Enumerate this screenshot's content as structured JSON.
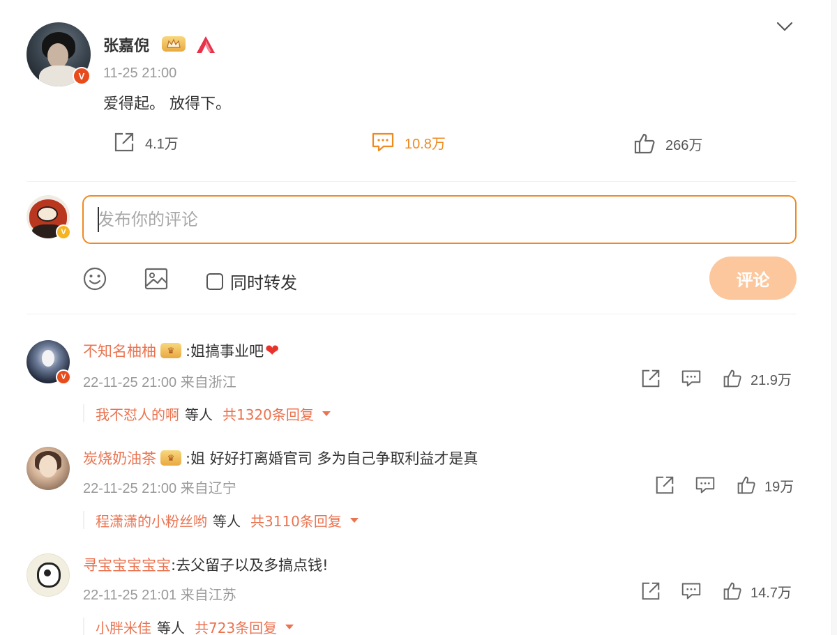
{
  "post": {
    "author": "张嘉倪",
    "time": "11-25 21:00",
    "text": "爱得起。 放得下。",
    "verified_badge": "V",
    "stats": {
      "repost": "4.1万",
      "comment": "10.8万",
      "like": "266万"
    }
  },
  "composer": {
    "placeholder": "发布你的评论",
    "repost_label": "同时转发",
    "submit_label": "评论",
    "verified_badge": "V"
  },
  "comments": [
    {
      "name": "不知名柚柚",
      "text": ":姐搞事业吧",
      "heart": "❤",
      "time": "22-11-25 21:00",
      "location": "来自浙江",
      "likes": "21.9万",
      "verified_badge": "V",
      "reply_user": "我不怼人的啊",
      "reply_etc": "等人",
      "reply_count": "共1320条回复"
    },
    {
      "name": "炭烧奶油茶",
      "text": ":姐 好好打离婚官司 多为自己争取利益才是真",
      "time": "22-11-25 21:00",
      "location": "来自辽宁",
      "likes": "19万",
      "reply_user": "程潇潇的小粉丝哟",
      "reply_etc": "等人",
      "reply_count": "共3110条回复"
    },
    {
      "name": "寻宝宝宝宝宝",
      "text": ":去父留子以及多搞点钱!",
      "time": "22-11-25 21:01",
      "location": "来自江苏",
      "likes": "14.7万",
      "reply_user": "小胖米佳",
      "reply_etc": "等人",
      "reply_count": "共723条回复"
    }
  ],
  "icons": {
    "expand": "chevron-down-icon",
    "repost": "share-icon",
    "comment": "comment-icon",
    "like": "thumbs-up-icon",
    "emoji": "emoji-icon",
    "image": "image-icon",
    "crown": "crown-badge-icon"
  },
  "colors": {
    "accent": "#ef8a21",
    "username": "#eb7350",
    "muted": "#999999",
    "submit_disabled": "#fcc79c",
    "verified": "#e84b1c"
  }
}
